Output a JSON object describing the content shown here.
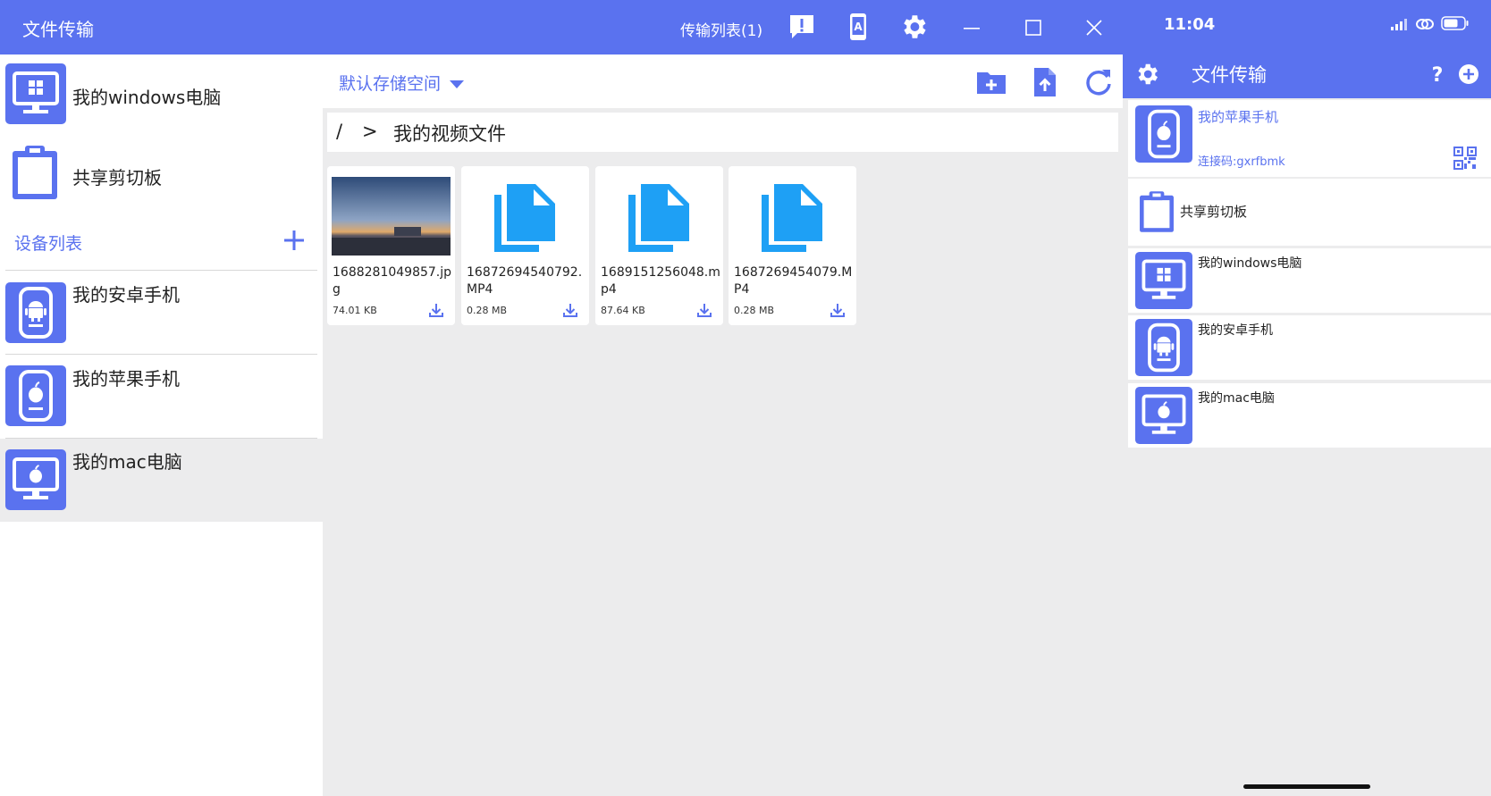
{
  "desktop": {
    "title": "文件传输",
    "transfer_list": "传输列表(1)",
    "sidebar": {
      "pc_device": "我的windows电脑",
      "clipboard": "共享剪切板",
      "device_list_title": "设备列表",
      "devices": [
        {
          "label": "我的安卓手机",
          "icon": "android-device-icon"
        },
        {
          "label": "我的苹果手机",
          "icon": "apple-phone-icon"
        },
        {
          "label": "我的mac电脑",
          "icon": "mac-monitor-icon"
        }
      ]
    },
    "storage": "默认存储空间",
    "breadcrumb": {
      "root": "/",
      "separator": ">",
      "current": "我的视频文件"
    },
    "files": [
      {
        "name": "1688281049857.jpg",
        "size": "74.01  KB",
        "type": "image"
      },
      {
        "name": "16872694540792.MP4",
        "size": "0.28  MB",
        "type": "document"
      },
      {
        "name": "1689151256048.mp4",
        "size": "87.64  KB",
        "type": "document"
      },
      {
        "name": "1687269454079.MP4",
        "size": "0.28  MB",
        "type": "document"
      }
    ]
  },
  "phone": {
    "time": "11:04",
    "title": "文件传输",
    "cards": [
      {
        "label": "我的苹果手机",
        "sub": "连接码:gxrfbmk",
        "icon": "apple-phone-icon"
      },
      {
        "label": "共享剪切板",
        "icon": "clipboard-icon"
      },
      {
        "label": "我的windows电脑",
        "icon": "windows-monitor-icon"
      },
      {
        "label": "我的安卓手机",
        "icon": "android-device-icon"
      },
      {
        "label": "我的mac电脑",
        "icon": "mac-monitor-icon"
      }
    ]
  },
  "colors": {
    "accent": "#5a72ef",
    "file_icon": "#1ea0f5",
    "background": "#ececed"
  }
}
